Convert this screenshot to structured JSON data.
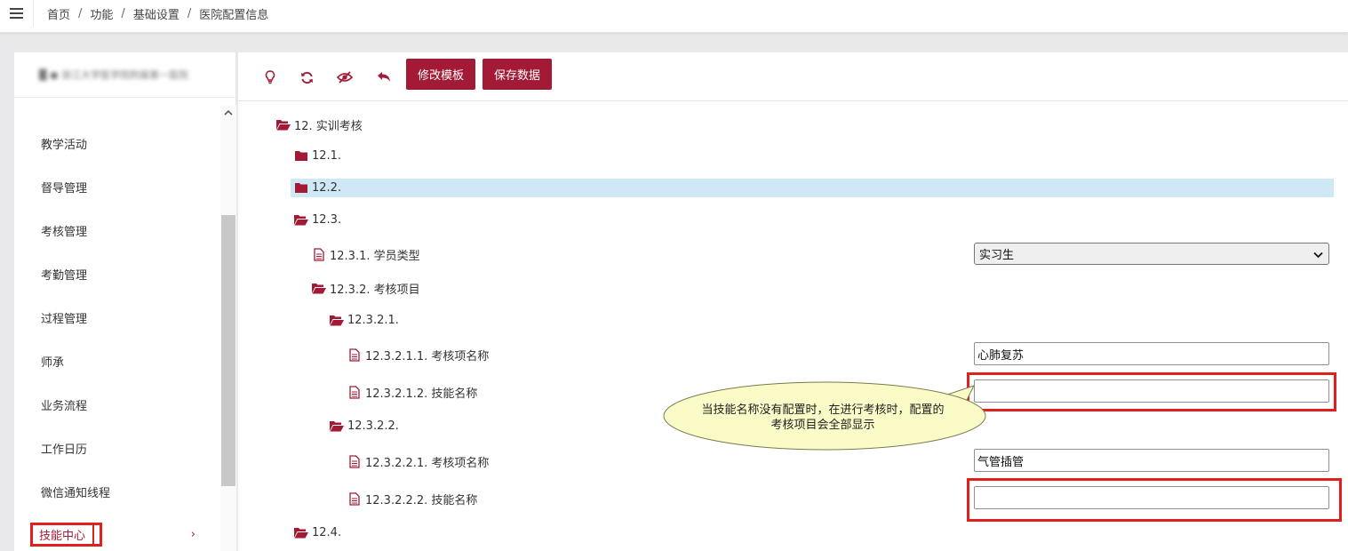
{
  "breadcrumb": {
    "home": "首页",
    "functions": "功能",
    "basic_settings": "基础设置",
    "current": "医院配置信息",
    "separator": "/"
  },
  "sidebar": {
    "org_name": "█ ● 浙江大学医学院附属第一医院",
    "items": [
      {
        "label": "教学活动"
      },
      {
        "label": "督导管理"
      },
      {
        "label": "考核管理"
      },
      {
        "label": "考勤管理"
      },
      {
        "label": "过程管理"
      },
      {
        "label": "师承"
      },
      {
        "label": "业务流程"
      },
      {
        "label": "工作日历"
      },
      {
        "label": "微信通知线程"
      },
      {
        "label": "技能中心",
        "active": true,
        "chevron": "›"
      }
    ]
  },
  "toolbar": {
    "icons": [
      "lightbulb-icon",
      "refresh-icon",
      "eye-slash-icon",
      "undo-icon"
    ],
    "edit_template_label": "修改模板",
    "save_data_label": "保存数据"
  },
  "tree": {
    "n12": "12. 实训考核",
    "n12_1": "12.1.",
    "n12_2": "12.2.",
    "n12_3": "12.3.",
    "n12_3_1": "12.3.1. 学员类型",
    "n12_3_2": "12.3.2. 考核项目",
    "n12_3_2_1": "12.3.2.1.",
    "n12_3_2_1_1": "12.3.2.1.1. 考核项名称",
    "n12_3_2_1_2": "12.3.2.1.2. 技能名称",
    "n12_3_2_2": "12.3.2.2.",
    "n12_3_2_2_1": "12.3.2.2.1. 考核项名称",
    "n12_3_2_2_2": "12.3.2.2.2. 技能名称",
    "n12_4": "12.4."
  },
  "fields": {
    "student_type": "实习生",
    "item1_name": "心肺复苏",
    "item1_skill": "",
    "item2_name": "气管插管",
    "item2_skill": ""
  },
  "callout": {
    "text": "当技能名称没有配置时，在进行考核时，配置的考核项目会全部显示"
  },
  "colors": {
    "accent": "#a31a36",
    "highlight": "#cfe8f6",
    "annotation_red": "#e0201c",
    "callout_fill": "#fbfbc8"
  }
}
